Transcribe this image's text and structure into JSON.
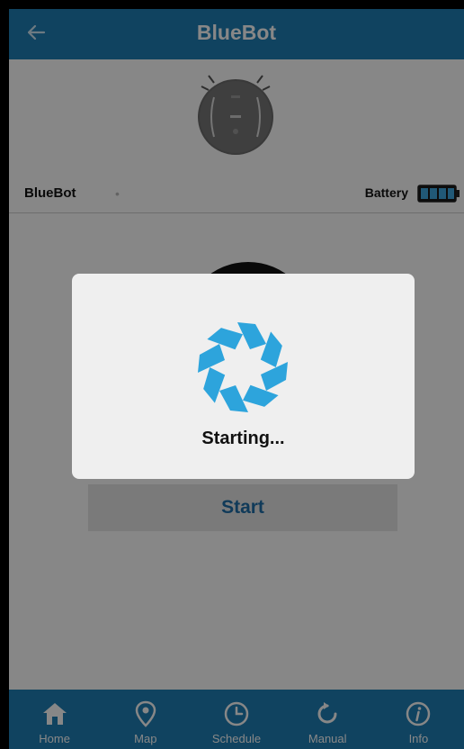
{
  "header": {
    "title": "BlueBot",
    "back_icon": "back-arrow-icon"
  },
  "status": {
    "device_name": "BlueBot",
    "device_dot": "•",
    "battery_label": "Battery",
    "battery_icon": "battery-full-icon"
  },
  "main": {
    "start_label": "Start"
  },
  "tabs": [
    {
      "label": "Home",
      "icon": "home-icon"
    },
    {
      "label": "Map",
      "icon": "map-pin-icon"
    },
    {
      "label": "Schedule",
      "icon": "clock-icon"
    },
    {
      "label": "Manual",
      "icon": "refresh-icon"
    },
    {
      "label": "Info",
      "icon": "info-icon"
    }
  ],
  "dialog": {
    "message": "Starting...",
    "icon": "spinner-icon"
  },
  "colors": {
    "brand_blue": "#1f7fb5",
    "accent_blue": "#2da4dc",
    "button_text": "#1f6fa8"
  }
}
